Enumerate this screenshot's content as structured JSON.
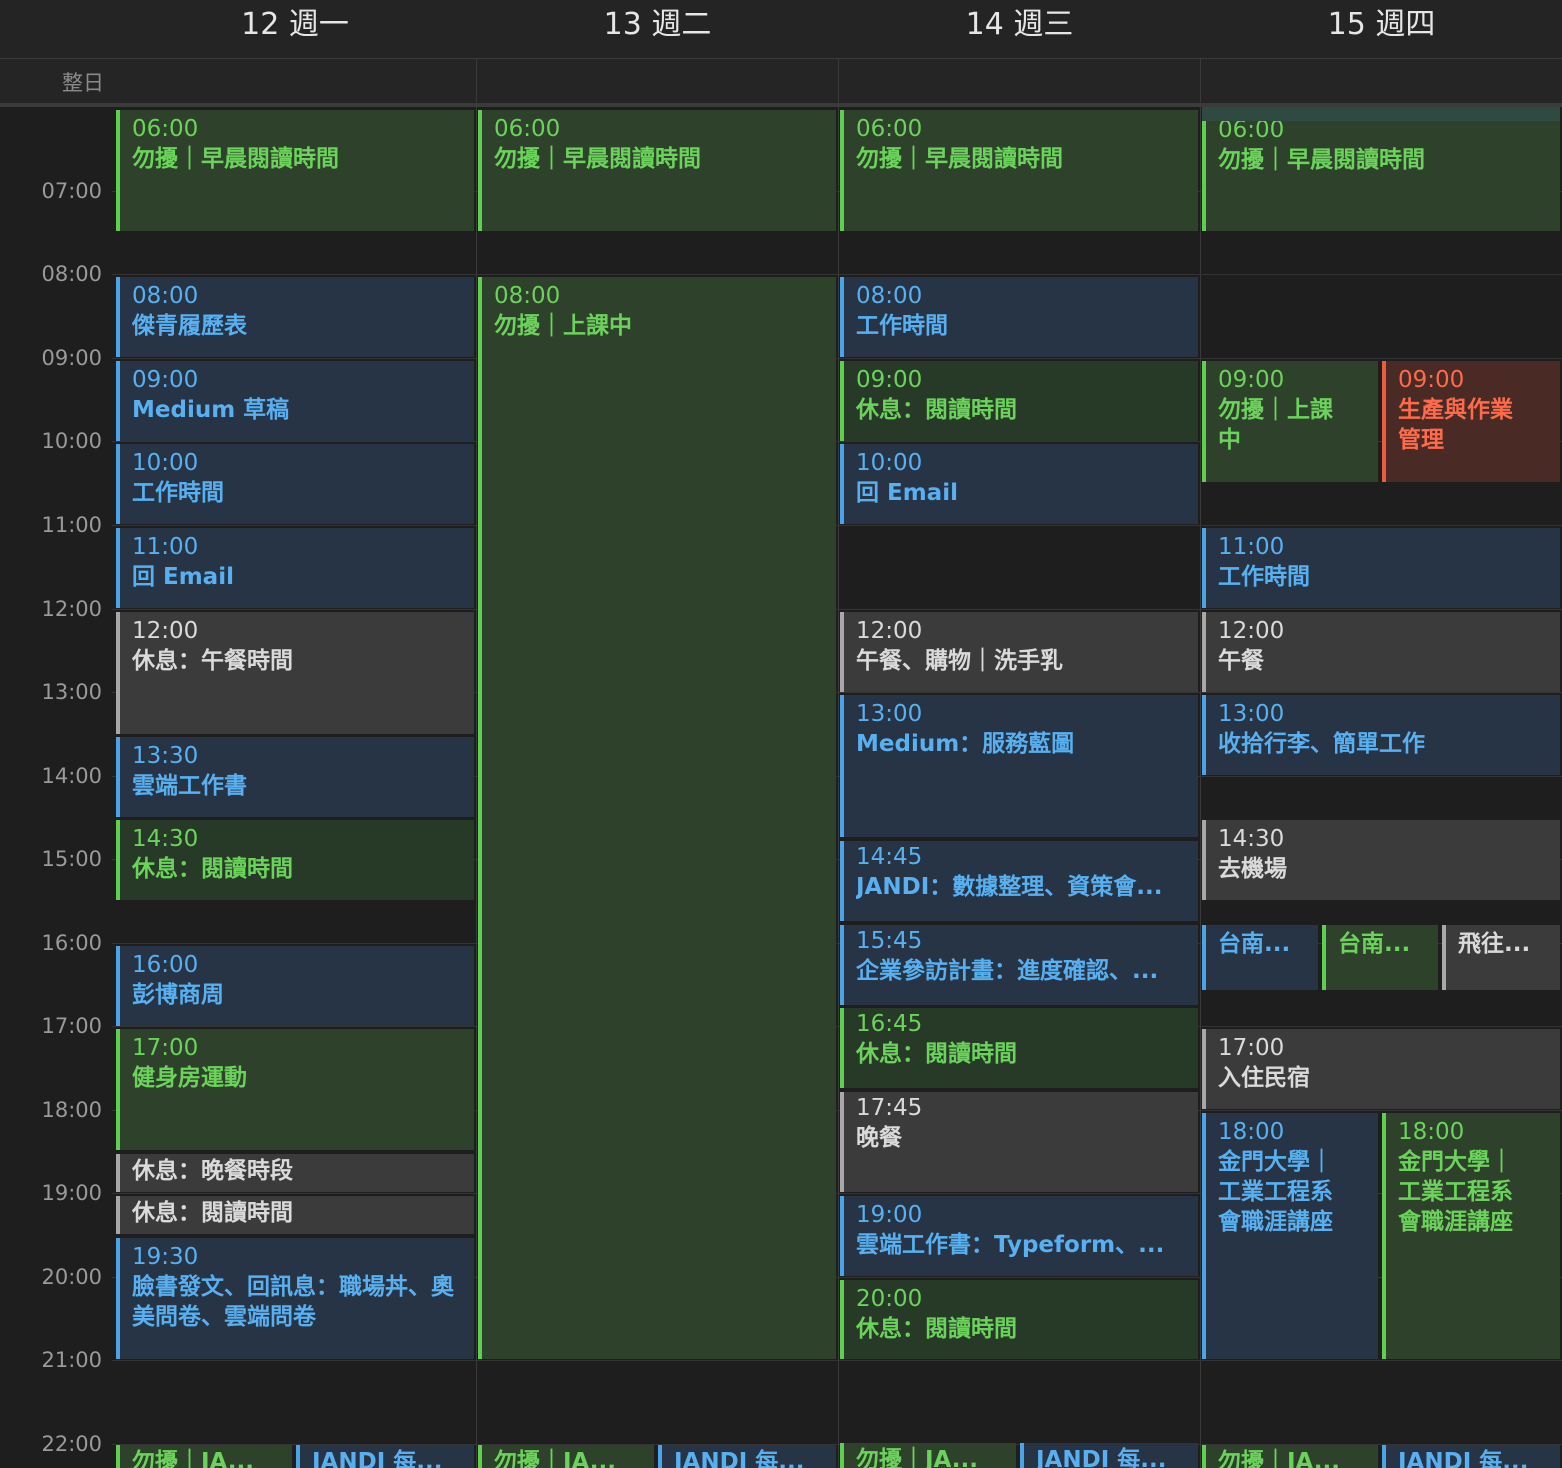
{
  "days": [
    {
      "label": "12 週一"
    },
    {
      "label": "13 週二"
    },
    {
      "label": "14 週三"
    },
    {
      "label": "15 週四"
    }
  ],
  "allday_label": "整日",
  "hours": [
    "07:00",
    "08:00",
    "09:00",
    "10:00",
    "11:00",
    "12:00",
    "13:00",
    "14:00",
    "15:00",
    "16:00",
    "17:00",
    "18:00",
    "19:00",
    "20:00",
    "21:00",
    "22:00"
  ],
  "colors": {
    "green": "#5fcf4f",
    "blue": "#4ba3e8",
    "gray": "#a8a8a8",
    "red": "#ef5b3c",
    "background": "#1e1e1e"
  },
  "events": {
    "mon": [
      {
        "time": "06:00",
        "title": "勿擾｜早晨閱讀時間"
      },
      {
        "time": "08:00",
        "title": "傑青履歷表"
      },
      {
        "time": "09:00",
        "title": "Medium 草稿"
      },
      {
        "time": "10:00",
        "title": "工作時間"
      },
      {
        "time": "11:00",
        "title": "回 Email"
      },
      {
        "time": "12:00",
        "title": "休息：午餐時間"
      },
      {
        "time": "13:30",
        "title": "雲端工作書"
      },
      {
        "time": "14:30",
        "title": "休息：閱讀時間"
      },
      {
        "time": "16:00",
        "title": "彭博商周"
      },
      {
        "time": "17:00",
        "title": "健身房運動"
      },
      {
        "time": "",
        "title": "休息：晚餐時段"
      },
      {
        "time": "",
        "title": "休息：閱讀時間"
      },
      {
        "time": "19:30",
        "title": "臉書發文、回訊息：職場丼、奧美問卷、雲端問卷"
      },
      {
        "time": "",
        "title": "勿擾｜JA..."
      },
      {
        "time": "",
        "title": "JANDI 每..."
      }
    ],
    "tue": [
      {
        "time": "06:00",
        "title": "勿擾｜早晨閱讀時間"
      },
      {
        "time": "08:00",
        "title": "勿擾｜上課中"
      },
      {
        "time": "",
        "title": "勿擾｜JA..."
      },
      {
        "time": "",
        "title": "JANDI 每..."
      }
    ],
    "wed": [
      {
        "time": "06:00",
        "title": "勿擾｜早晨閱讀時間"
      },
      {
        "time": "08:00",
        "title": "工作時間"
      },
      {
        "time": "09:00",
        "title": "休息：閱讀時間"
      },
      {
        "time": "10:00",
        "title": "回 Email"
      },
      {
        "time": "12:00",
        "title": "午餐、購物｜洗手乳"
      },
      {
        "time": "13:00",
        "title": "Medium：服務藍圖"
      },
      {
        "time": "14:45",
        "title": "JANDI：數據整理、資策會..."
      },
      {
        "time": "15:45",
        "title": "企業參訪計畫：進度確認、..."
      },
      {
        "time": "16:45",
        "title": "休息：閱讀時間"
      },
      {
        "time": "17:45",
        "title": "晚餐"
      },
      {
        "time": "19:00",
        "title": "雲端工作書：Typeform、..."
      },
      {
        "time": "20:00",
        "title": "休息：閱讀時間"
      },
      {
        "time": "",
        "title": "勿擾｜JA..."
      },
      {
        "time": "",
        "title": "JANDI 每..."
      }
    ],
    "thu": [
      {
        "time": "06:00",
        "title": "勿擾｜早晨閱讀時間"
      },
      {
        "time": "09:00",
        "title": "勿擾｜上課中"
      },
      {
        "time": "09:00",
        "title": "生產與作業管理"
      },
      {
        "time": "11:00",
        "title": "工作時間"
      },
      {
        "time": "12:00",
        "title": "午餐"
      },
      {
        "time": "13:00",
        "title": "收拾行李、簡單工作"
      },
      {
        "time": "14:30",
        "title": "去機場"
      },
      {
        "time": "",
        "title": "台南..."
      },
      {
        "time": "",
        "title": "台南..."
      },
      {
        "time": "",
        "title": "飛往..."
      },
      {
        "time": "17:00",
        "title": "入住民宿"
      },
      {
        "time": "18:00",
        "title": "金門大學｜工業工程系會職涯講座"
      },
      {
        "time": "18:00",
        "title": "金門大學｜工業工程系會職涯講座"
      },
      {
        "time": "",
        "title": "勿擾｜JA..."
      },
      {
        "time": "",
        "title": "JANDI 每..."
      }
    ]
  }
}
